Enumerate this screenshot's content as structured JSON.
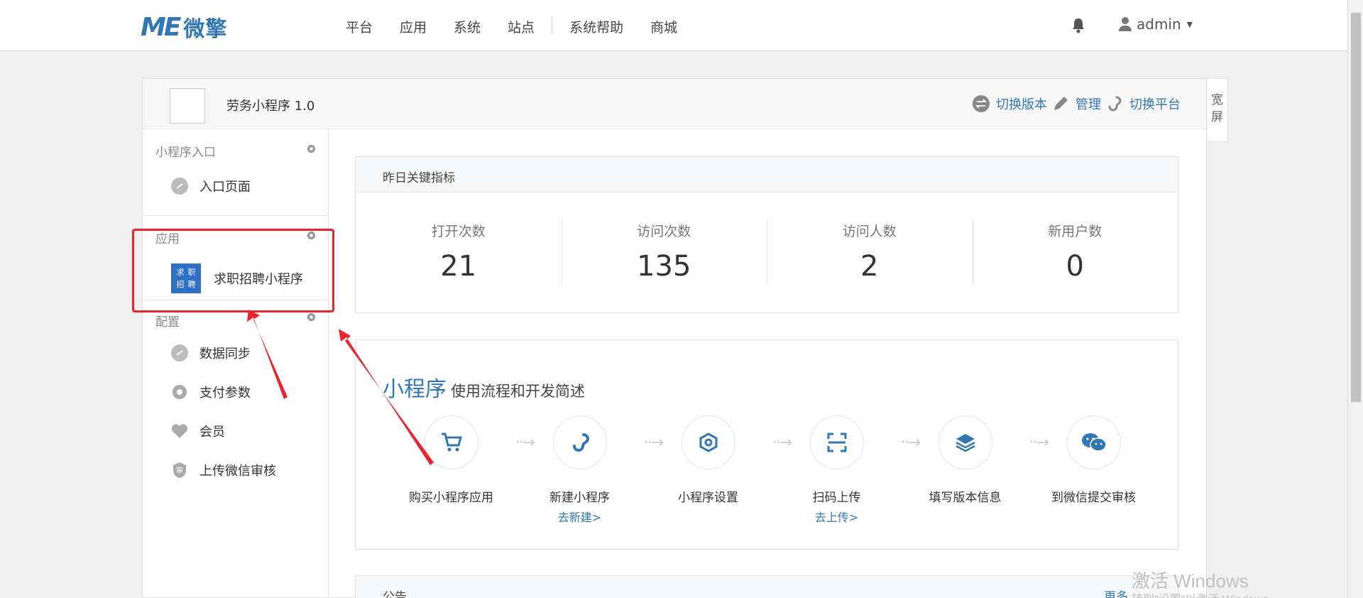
{
  "header": {
    "logo_me": "ME",
    "logo_cn": "微擎",
    "nav": [
      "平台",
      "应用",
      "系统",
      "站点",
      "系统帮助",
      "商城"
    ],
    "user": "admin"
  },
  "panel": {
    "app_title": "劳务小程序 1.0",
    "actions": {
      "switch_version": "切换版本",
      "manage": "管理",
      "switch_platform": "切换平台"
    },
    "wide_screen": "宽屏"
  },
  "sidebar": {
    "group_entry": {
      "title": "小程序入口",
      "items": [
        {
          "label": "入口页面"
        }
      ]
    },
    "group_app": {
      "title": "应用",
      "items": [
        {
          "label": "求职招聘小程序",
          "badge": [
            "求",
            "职",
            "招",
            "聘"
          ]
        }
      ]
    },
    "group_config": {
      "title": "配置",
      "items": [
        {
          "label": "数据同步"
        },
        {
          "label": "支付参数"
        },
        {
          "label": "会员"
        },
        {
          "label": "上传微信审核"
        }
      ]
    }
  },
  "metrics": {
    "title": "昨日关键指标",
    "items": [
      {
        "label": "打开次数",
        "value": "21"
      },
      {
        "label": "访问次数",
        "value": "135"
      },
      {
        "label": "访问人数",
        "value": "2"
      },
      {
        "label": "新用户数",
        "value": "0"
      }
    ]
  },
  "flow": {
    "title_big": "小程序",
    "title_small": "使用流程和开发简述",
    "steps": [
      {
        "name": "购买小程序应用",
        "link": "",
        "icon": "cart-icon"
      },
      {
        "name": "新建小程序",
        "link": "去新建>",
        "icon": "link-icon"
      },
      {
        "name": "小程序设置",
        "link": "",
        "icon": "settings-icon"
      },
      {
        "name": "扫码上传",
        "link": "去上传>",
        "icon": "scan-icon"
      },
      {
        "name": "填写版本信息",
        "link": "",
        "icon": "layers-icon"
      },
      {
        "name": "到微信提交审核",
        "link": "",
        "icon": "wechat-icon"
      }
    ]
  },
  "notice": {
    "title": "公告",
    "more": "更多"
  },
  "watermark": {
    "line1": "激活 Windows",
    "line2": "转到\"设置\"以激活 Windows。"
  },
  "colors": {
    "accent": "#3277b3",
    "highlight": "#e8242e"
  }
}
